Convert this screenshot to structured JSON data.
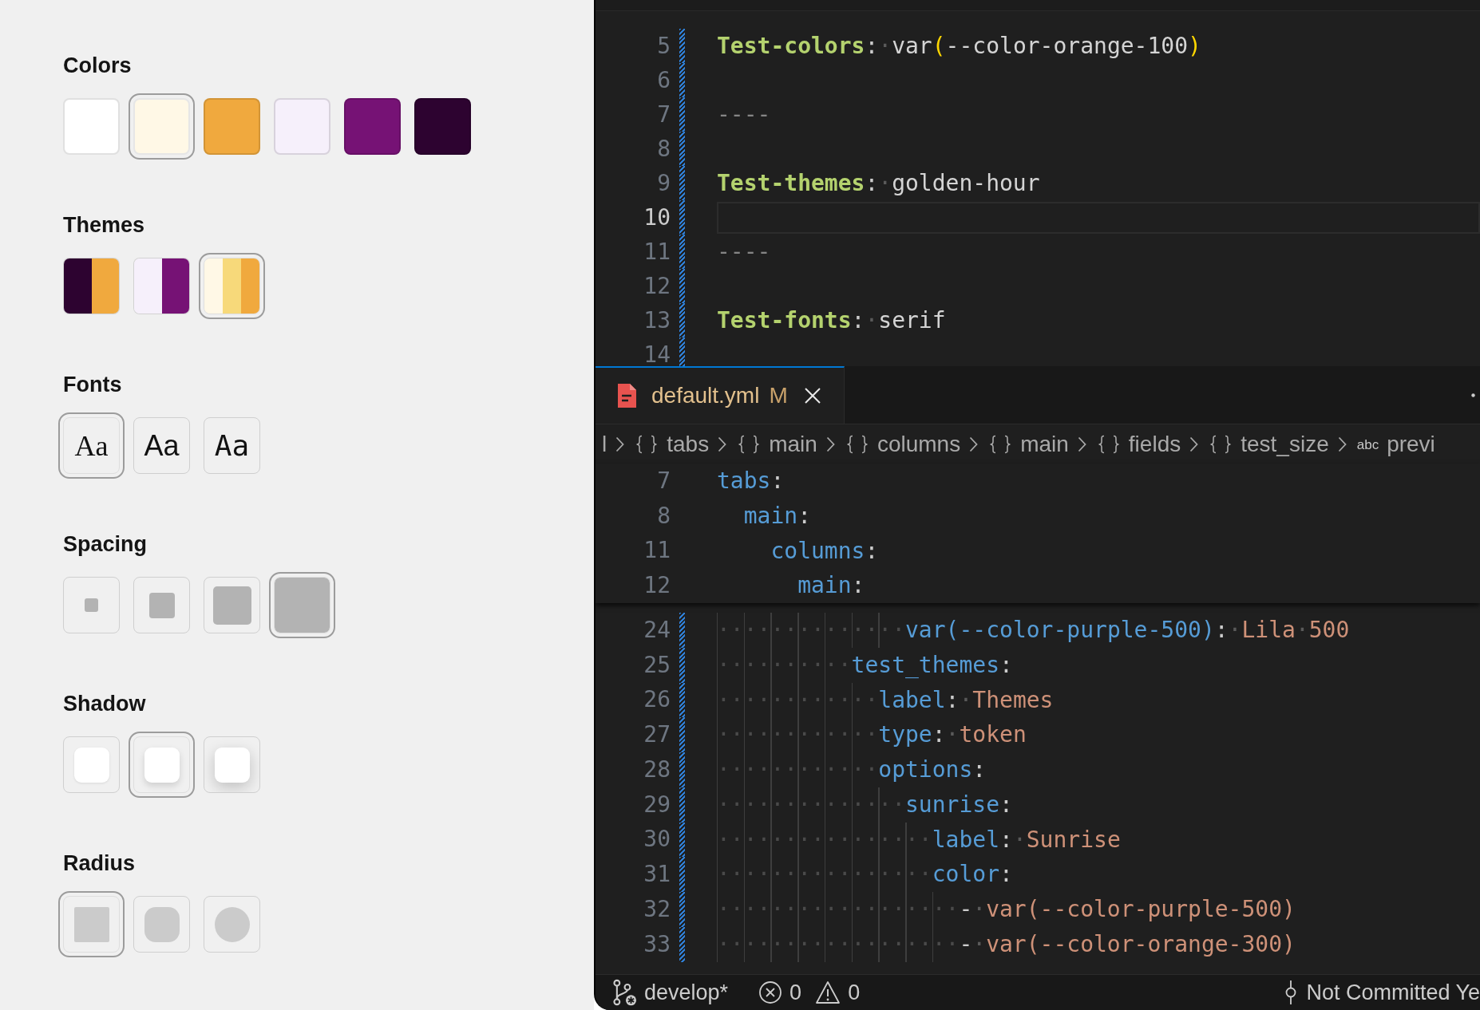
{
  "settings": {
    "sections": [
      {
        "title": "Colors",
        "kind": "color",
        "options": [
          {
            "color": "#ffffff",
            "selected": false
          },
          {
            "color": "#fff8e6",
            "selected": true
          },
          {
            "color": "#f0a93e",
            "selected": false
          },
          {
            "color": "#f6f0fb",
            "selected": false
          },
          {
            "color": "#761275",
            "selected": false
          },
          {
            "color": "#2d0330",
            "selected": false
          }
        ]
      },
      {
        "title": "Themes",
        "kind": "theme",
        "options": [
          {
            "stripes": [
              {
                "color": "#2d0330"
              },
              {
                "color": "#f0a93e"
              }
            ],
            "selected": false
          },
          {
            "stripes": [
              {
                "color": "#f6f0fb"
              },
              {
                "color": "#761275"
              }
            ],
            "selected": false
          },
          {
            "stripes": [
              {
                "color": "#fff8e6"
              },
              {
                "color": "#f7d97a"
              },
              {
                "color": "#f0a93e"
              }
            ],
            "selected": true
          }
        ]
      },
      {
        "title": "Fonts",
        "kind": "font",
        "options": [
          {
            "label": "Aa",
            "kind": "serif",
            "selected": true
          },
          {
            "label": "Aa",
            "kind": "sans",
            "selected": false
          },
          {
            "label": "Aa",
            "kind": "mono",
            "selected": false
          }
        ]
      },
      {
        "title": "Spacing",
        "kind": "spacing",
        "options": [
          {
            "kind": "xs",
            "selected": false
          },
          {
            "kind": "s",
            "selected": false
          },
          {
            "kind": "m",
            "selected": false
          },
          {
            "kind": "l",
            "selected": true
          }
        ]
      },
      {
        "title": "Shadow",
        "kind": "shadow",
        "options": [
          {
            "kind": "sm",
            "selected": false
          },
          {
            "kind": "md",
            "selected": true
          },
          {
            "kind": "lg",
            "selected": false
          }
        ]
      },
      {
        "title": "Radius",
        "kind": "radius",
        "options": [
          {
            "kind": "none",
            "selected": true
          },
          {
            "kind": "md",
            "selected": false
          },
          {
            "kind": "full",
            "selected": false
          }
        ]
      }
    ]
  },
  "editor": {
    "top_pane": {
      "lines": [
        {
          "number": "5",
          "changed": true,
          "current": false,
          "tokens": [
            {
              "kind": "heading",
              "text": "Test-colors"
            },
            {
              "kind": "punct",
              "text": ":"
            },
            {
              "kind": "ws",
              "text": "·"
            },
            {
              "kind": "plain",
              "text": "var"
            },
            {
              "kind": "bracket",
              "text": "("
            },
            {
              "kind": "plain",
              "text": "--color-orange-100"
            },
            {
              "kind": "bracket",
              "text": ")"
            }
          ]
        },
        {
          "number": "6",
          "changed": true,
          "current": false
        },
        {
          "number": "7",
          "changed": true,
          "current": false,
          "tokens": [
            {
              "kind": "rule",
              "text": "----"
            }
          ]
        },
        {
          "number": "8",
          "changed": true,
          "current": false
        },
        {
          "number": "9",
          "changed": true,
          "current": false,
          "tokens": [
            {
              "kind": "heading",
              "text": "Test-themes"
            },
            {
              "kind": "punct",
              "text": ":"
            },
            {
              "kind": "ws",
              "text": "·"
            },
            {
              "kind": "plain",
              "text": "golden-hour"
            }
          ]
        },
        {
          "number": "10",
          "changed": true,
          "current": true
        },
        {
          "number": "11",
          "changed": true,
          "current": false,
          "tokens": [
            {
              "kind": "rule",
              "text": "----"
            }
          ]
        },
        {
          "number": "12",
          "changed": true,
          "current": false
        },
        {
          "number": "13",
          "changed": true,
          "current": false,
          "tokens": [
            {
              "kind": "heading",
              "text": "Test-fonts"
            },
            {
              "kind": "punct",
              "text": ":"
            },
            {
              "kind": "ws",
              "text": "·"
            },
            {
              "kind": "plain",
              "text": "serif"
            }
          ]
        },
        {
          "number": "14",
          "changed": true,
          "current": false
        }
      ]
    },
    "bottom_pane": {
      "tab": {
        "label": "default.yml",
        "badge": "M",
        "modified": true,
        "selected": true
      },
      "breadcrumbs": [
        {
          "label": "l",
          "kind": "file"
        },
        {
          "label": "tabs",
          "kind": "object"
        },
        {
          "label": "main",
          "kind": "object"
        },
        {
          "label": "columns",
          "kind": "object"
        },
        {
          "label": "main",
          "kind": "object"
        },
        {
          "label": "fields",
          "kind": "object"
        },
        {
          "label": "test_size",
          "kind": "object"
        },
        {
          "label": "previ",
          "kind": "string",
          "symbol": "abc"
        }
      ],
      "sticky_lines": [
        {
          "number": "7",
          "tokens": [
            {
              "kind": "key",
              "text": "tabs"
            },
            {
              "kind": "punct",
              "text": ":"
            }
          ],
          "children": [
            {
              "number": "8",
              "tokens": [
                {
                  "kind": "key",
                  "text": "main"
                },
                {
                  "kind": "punct",
                  "text": ":"
                }
              ],
              "children": [
                {
                  "number": "11",
                  "tokens": [
                    {
                      "kind": "key",
                      "text": "columns"
                    },
                    {
                      "kind": "punct",
                      "text": ":"
                    }
                  ],
                  "children": [
                    {
                      "number": "12",
                      "tokens": [
                        {
                          "kind": "key",
                          "text": "main"
                        },
                        {
                          "kind": "punct",
                          "text": ":"
                        }
                      ]
                    }
                  ]
                }
              ]
            }
          ]
        }
      ],
      "lines": [
        {
          "number": "24",
          "changed": true,
          "tokens": [
            {
              "kind": "indent",
              "text": "··············"
            },
            {
              "kind": "key",
              "text": "var(--color-purple-500)"
            },
            {
              "kind": "punct",
              "text": ":"
            },
            {
              "kind": "ws",
              "text": "·"
            },
            {
              "kind": "string",
              "text": "Lila"
            },
            {
              "kind": "ws",
              "text": "·"
            },
            {
              "kind": "string",
              "text": "500"
            }
          ]
        },
        {
          "number": "25",
          "changed": true,
          "tokens": [
            {
              "kind": "indent",
              "text": "··········"
            },
            {
              "kind": "key",
              "text": "test_themes"
            },
            {
              "kind": "punct",
              "text": ":"
            }
          ]
        },
        {
          "number": "26",
          "changed": true,
          "tokens": [
            {
              "kind": "indent",
              "text": "············"
            },
            {
              "kind": "key",
              "text": "label"
            },
            {
              "kind": "punct",
              "text": ":"
            },
            {
              "kind": "ws",
              "text": "·"
            },
            {
              "kind": "string",
              "text": "Themes"
            }
          ]
        },
        {
          "number": "27",
          "changed": true,
          "tokens": [
            {
              "kind": "indent",
              "text": "············"
            },
            {
              "kind": "key",
              "text": "type"
            },
            {
              "kind": "punct",
              "text": ":"
            },
            {
              "kind": "ws",
              "text": "·"
            },
            {
              "kind": "string",
              "text": "token"
            }
          ]
        },
        {
          "number": "28",
          "changed": true,
          "tokens": [
            {
              "kind": "indent",
              "text": "············"
            },
            {
              "kind": "key",
              "text": "options"
            },
            {
              "kind": "punct",
              "text": ":"
            }
          ]
        },
        {
          "number": "29",
          "changed": true,
          "tokens": [
            {
              "kind": "indent",
              "text": "··············"
            },
            {
              "kind": "key",
              "text": "sunrise"
            },
            {
              "kind": "punct",
              "text": ":"
            }
          ]
        },
        {
          "number": "30",
          "changed": true,
          "tokens": [
            {
              "kind": "indent",
              "text": "················"
            },
            {
              "kind": "key",
              "text": "label"
            },
            {
              "kind": "punct",
              "text": ":"
            },
            {
              "kind": "ws",
              "text": "·"
            },
            {
              "kind": "string",
              "text": "Sunrise"
            }
          ]
        },
        {
          "number": "31",
          "changed": true,
          "tokens": [
            {
              "kind": "indent",
              "text": "················"
            },
            {
              "kind": "key",
              "text": "color"
            },
            {
              "kind": "punct",
              "text": ":"
            }
          ]
        },
        {
          "number": "32",
          "changed": true,
          "tokens": [
            {
              "kind": "indent",
              "text": "··················"
            },
            {
              "kind": "punct",
              "text": "-"
            },
            {
              "kind": "ws",
              "text": "·"
            },
            {
              "kind": "string",
              "text": "var(--color-purple-500)"
            }
          ]
        },
        {
          "number": "33",
          "changed": true,
          "tokens": [
            {
              "kind": "indent",
              "text": "··················"
            },
            {
              "kind": "punct",
              "text": "-"
            },
            {
              "kind": "ws",
              "text": "·"
            },
            {
              "kind": "string",
              "text": "var(--color-orange-300)"
            }
          ]
        }
      ]
    },
    "status_bar": {
      "branch": "develop*",
      "errors": "0",
      "warnings": "0",
      "commit": "Not Committed Ye"
    }
  }
}
